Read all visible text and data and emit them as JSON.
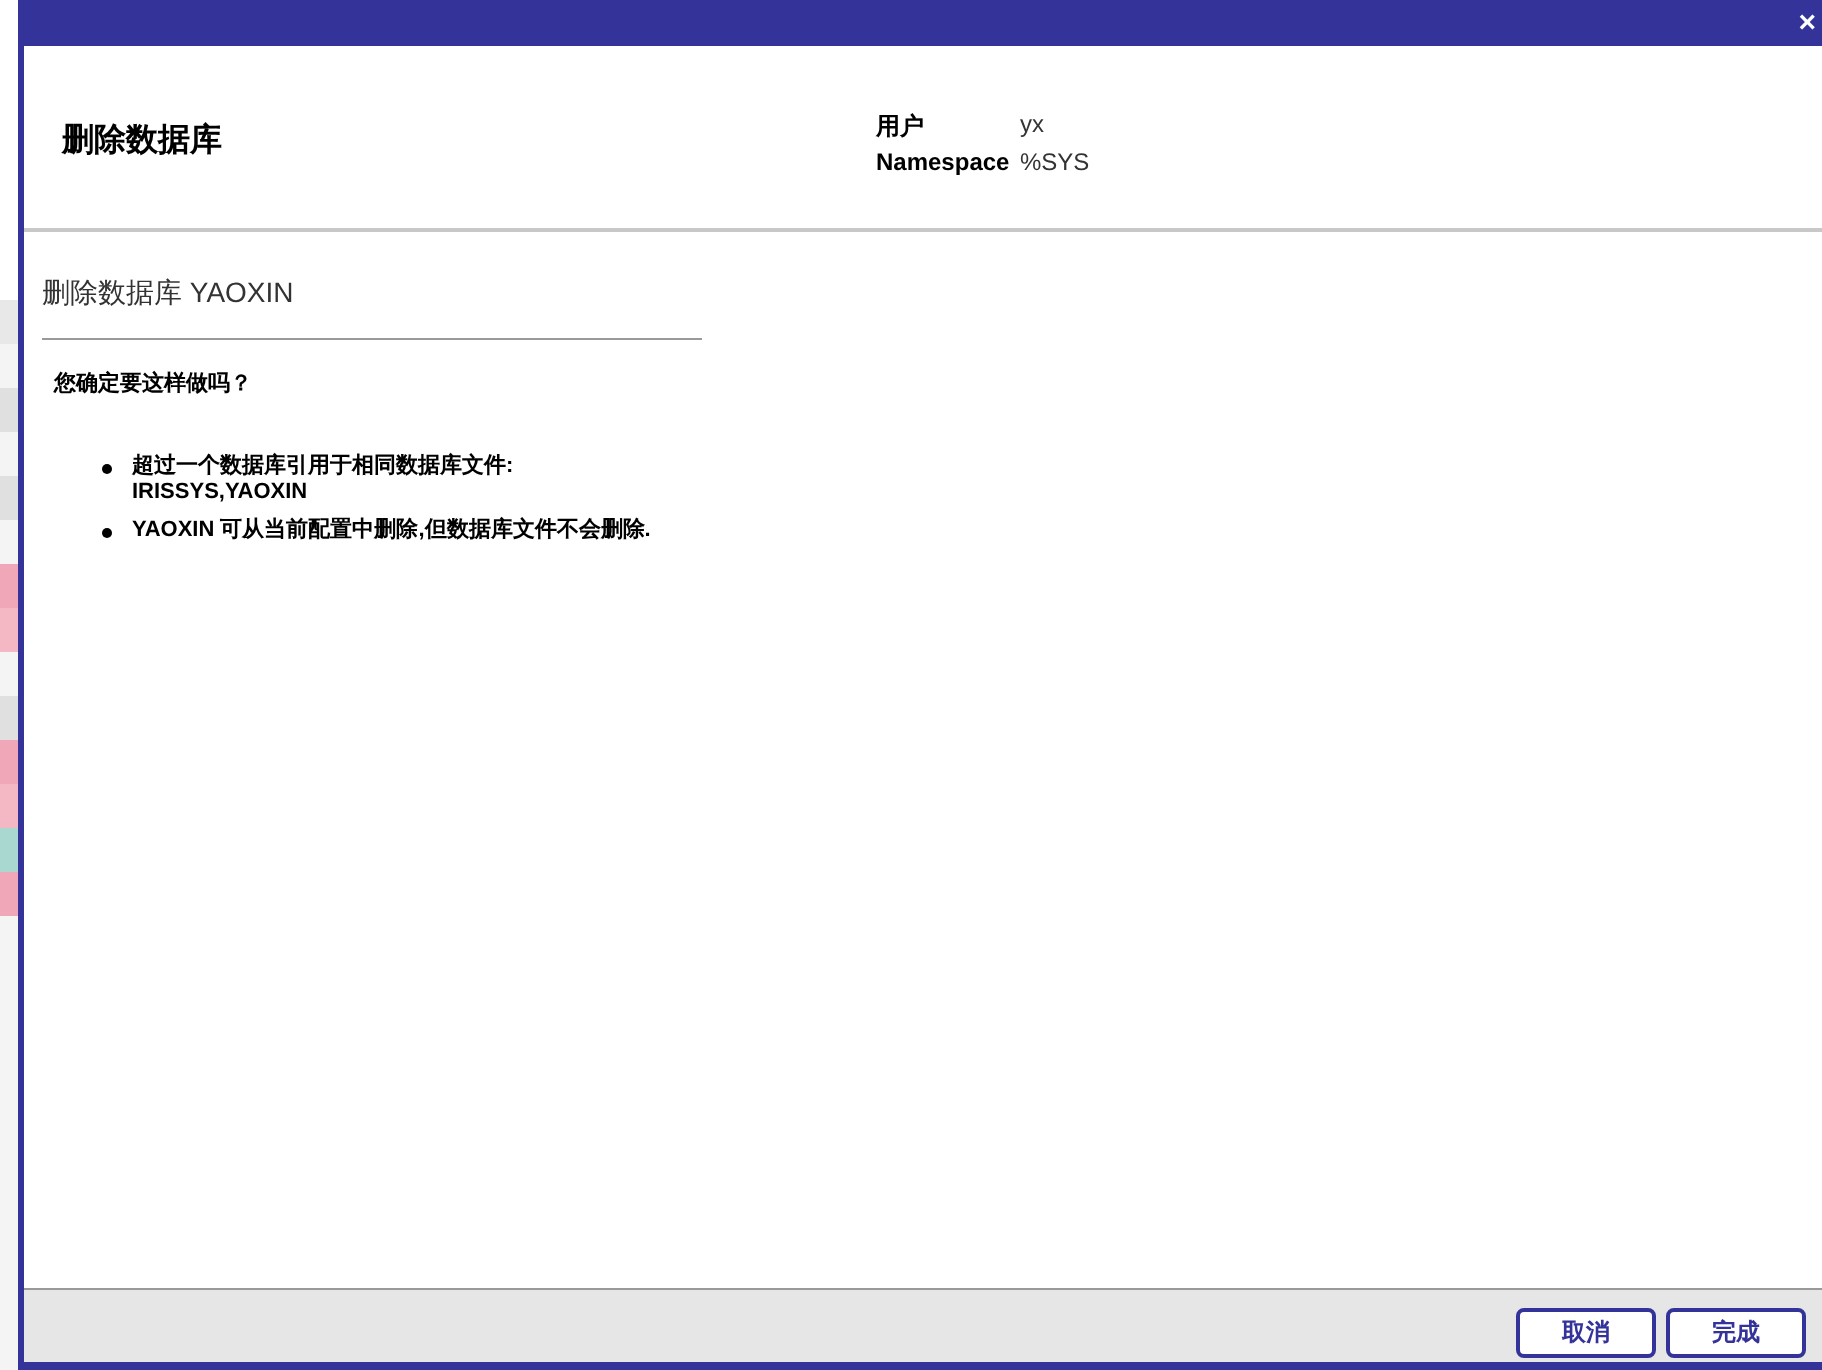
{
  "window": {
    "close": "×"
  },
  "header": {
    "title": "删除数据库",
    "info": [
      {
        "label": "用户",
        "value": "yx"
      },
      {
        "label": "Namespace",
        "value": "%SYS"
      }
    ]
  },
  "subtitle": "删除数据库 YAOXIN",
  "question": "您确定要这样做吗？",
  "notes": [
    {
      "lines": [
        "超过一个数据库引用于相同数据库文件:",
        "IRISSYS,YAOXIN"
      ]
    },
    {
      "lines": [
        "YAOXIN 可从当前配置中删除,但数据库文件不会删除."
      ]
    }
  ],
  "buttons": [
    {
      "label": "取消"
    },
    {
      "label": "完成"
    }
  ]
}
